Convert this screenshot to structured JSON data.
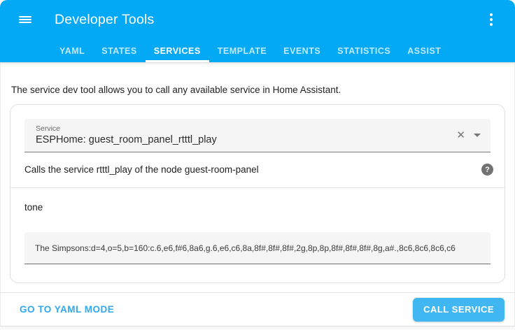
{
  "colors": {
    "header_bg": "#03a9f4",
    "active_tab_indicator": "#ffffff",
    "link_blue": "#30a7ee",
    "call_button_bg": "#41b7f1",
    "card_border": "#e0e0e0",
    "field_fill": "#f5f5f5"
  },
  "header": {
    "title": "Developer Tools",
    "active_tab": "SERVICES",
    "tabs": [
      {
        "label": "YAML"
      },
      {
        "label": "STATES"
      },
      {
        "label": "SERVICES"
      },
      {
        "label": "TEMPLATE"
      },
      {
        "label": "EVENTS"
      },
      {
        "label": "STATISTICS"
      },
      {
        "label": "ASSIST"
      }
    ]
  },
  "intro": "The service dev tool allows you to call any available service in Home Assistant.",
  "service_card": {
    "service_field": {
      "label": "Service",
      "value": "ESPHome: guest_room_panel_rtttl_play"
    },
    "description": "Calls the service rtttl_play of the node guest-room-panel",
    "help_icon_glyph": "?",
    "clear_icon_glyph": "✕",
    "data_field": {
      "name": "tone",
      "value": "The Simpsons:d=4,o=5,b=160:c.6,e6,f#6,8a6,g.6,e6,c6,8a,8f#,8f#,8f#,2g,8p,8p,8f#,8f#,8f#,8g,a#.,8c6,8c6,8c6,c6"
    }
  },
  "footer": {
    "yaml_mode_label": "GO TO YAML MODE",
    "call_service_label": "CALL SERVICE"
  }
}
